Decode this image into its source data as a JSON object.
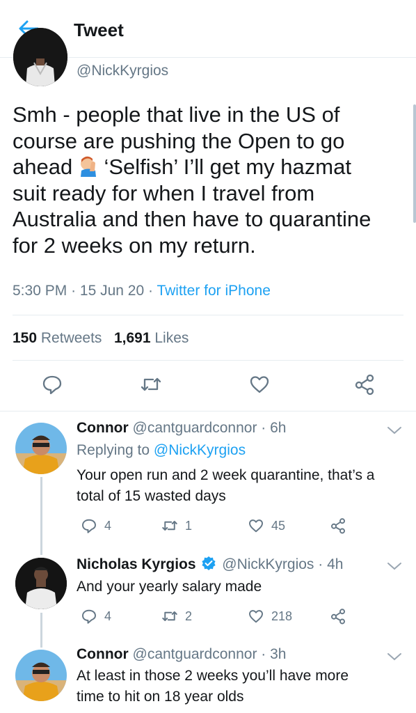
{
  "header": {
    "title": "Tweet",
    "back_icon": "arrow-left-icon"
  },
  "main_tweet": {
    "handle": "@NickKyrgios",
    "text_line1": "Smh - people that live in the US of",
    "text_line2": "course are pushing the Open to go",
    "text_line3_pre": "ahead",
    "text_line3_post": "‘Selfish’ I’ll get my hazmat",
    "text_line4": "suit ready for when I travel from",
    "text_line5": "Australia and then have to quarantine",
    "text_line6": "for 2 weeks on my return.",
    "emoji": "facepalm-emoji",
    "time": "5:30 PM",
    "sep": "·",
    "date": "15 Jun 20",
    "source": "Twitter for iPhone",
    "retweets_count": "150",
    "retweets_label": "Retweets",
    "likes_count": "1,691",
    "likes_label": "Likes"
  },
  "replies": [
    {
      "name": "Connor",
      "handle": "@cantguardconnor",
      "sep": "·",
      "time": "6h",
      "replying_prefix": "Replying to",
      "replying_to": "@NickKyrgios",
      "text_line1": "Your open run and 2 week quarantine, that’s a",
      "text_line2": "total of 15 wasted days",
      "reply_count": "4",
      "retweet_count": "1",
      "like_count": "45"
    },
    {
      "name": "Nicholas Kyrgios",
      "handle": "@NickKyrgios",
      "sep": "·",
      "time": "4h",
      "text_line1": "And your yearly salary made",
      "reply_count": "4",
      "retweet_count": "2",
      "like_count": "218"
    },
    {
      "name": "Connor",
      "handle": "@cantguardconnor",
      "sep": "·",
      "time": "3h",
      "text_line1": "At least in those 2 weeks you’ll have more",
      "text_line2": "time to hit on 18 year olds"
    }
  ],
  "colors": {
    "accent": "#1da1f2",
    "text": "#14171a",
    "muted": "#657786",
    "divider": "#e6ecf0"
  }
}
